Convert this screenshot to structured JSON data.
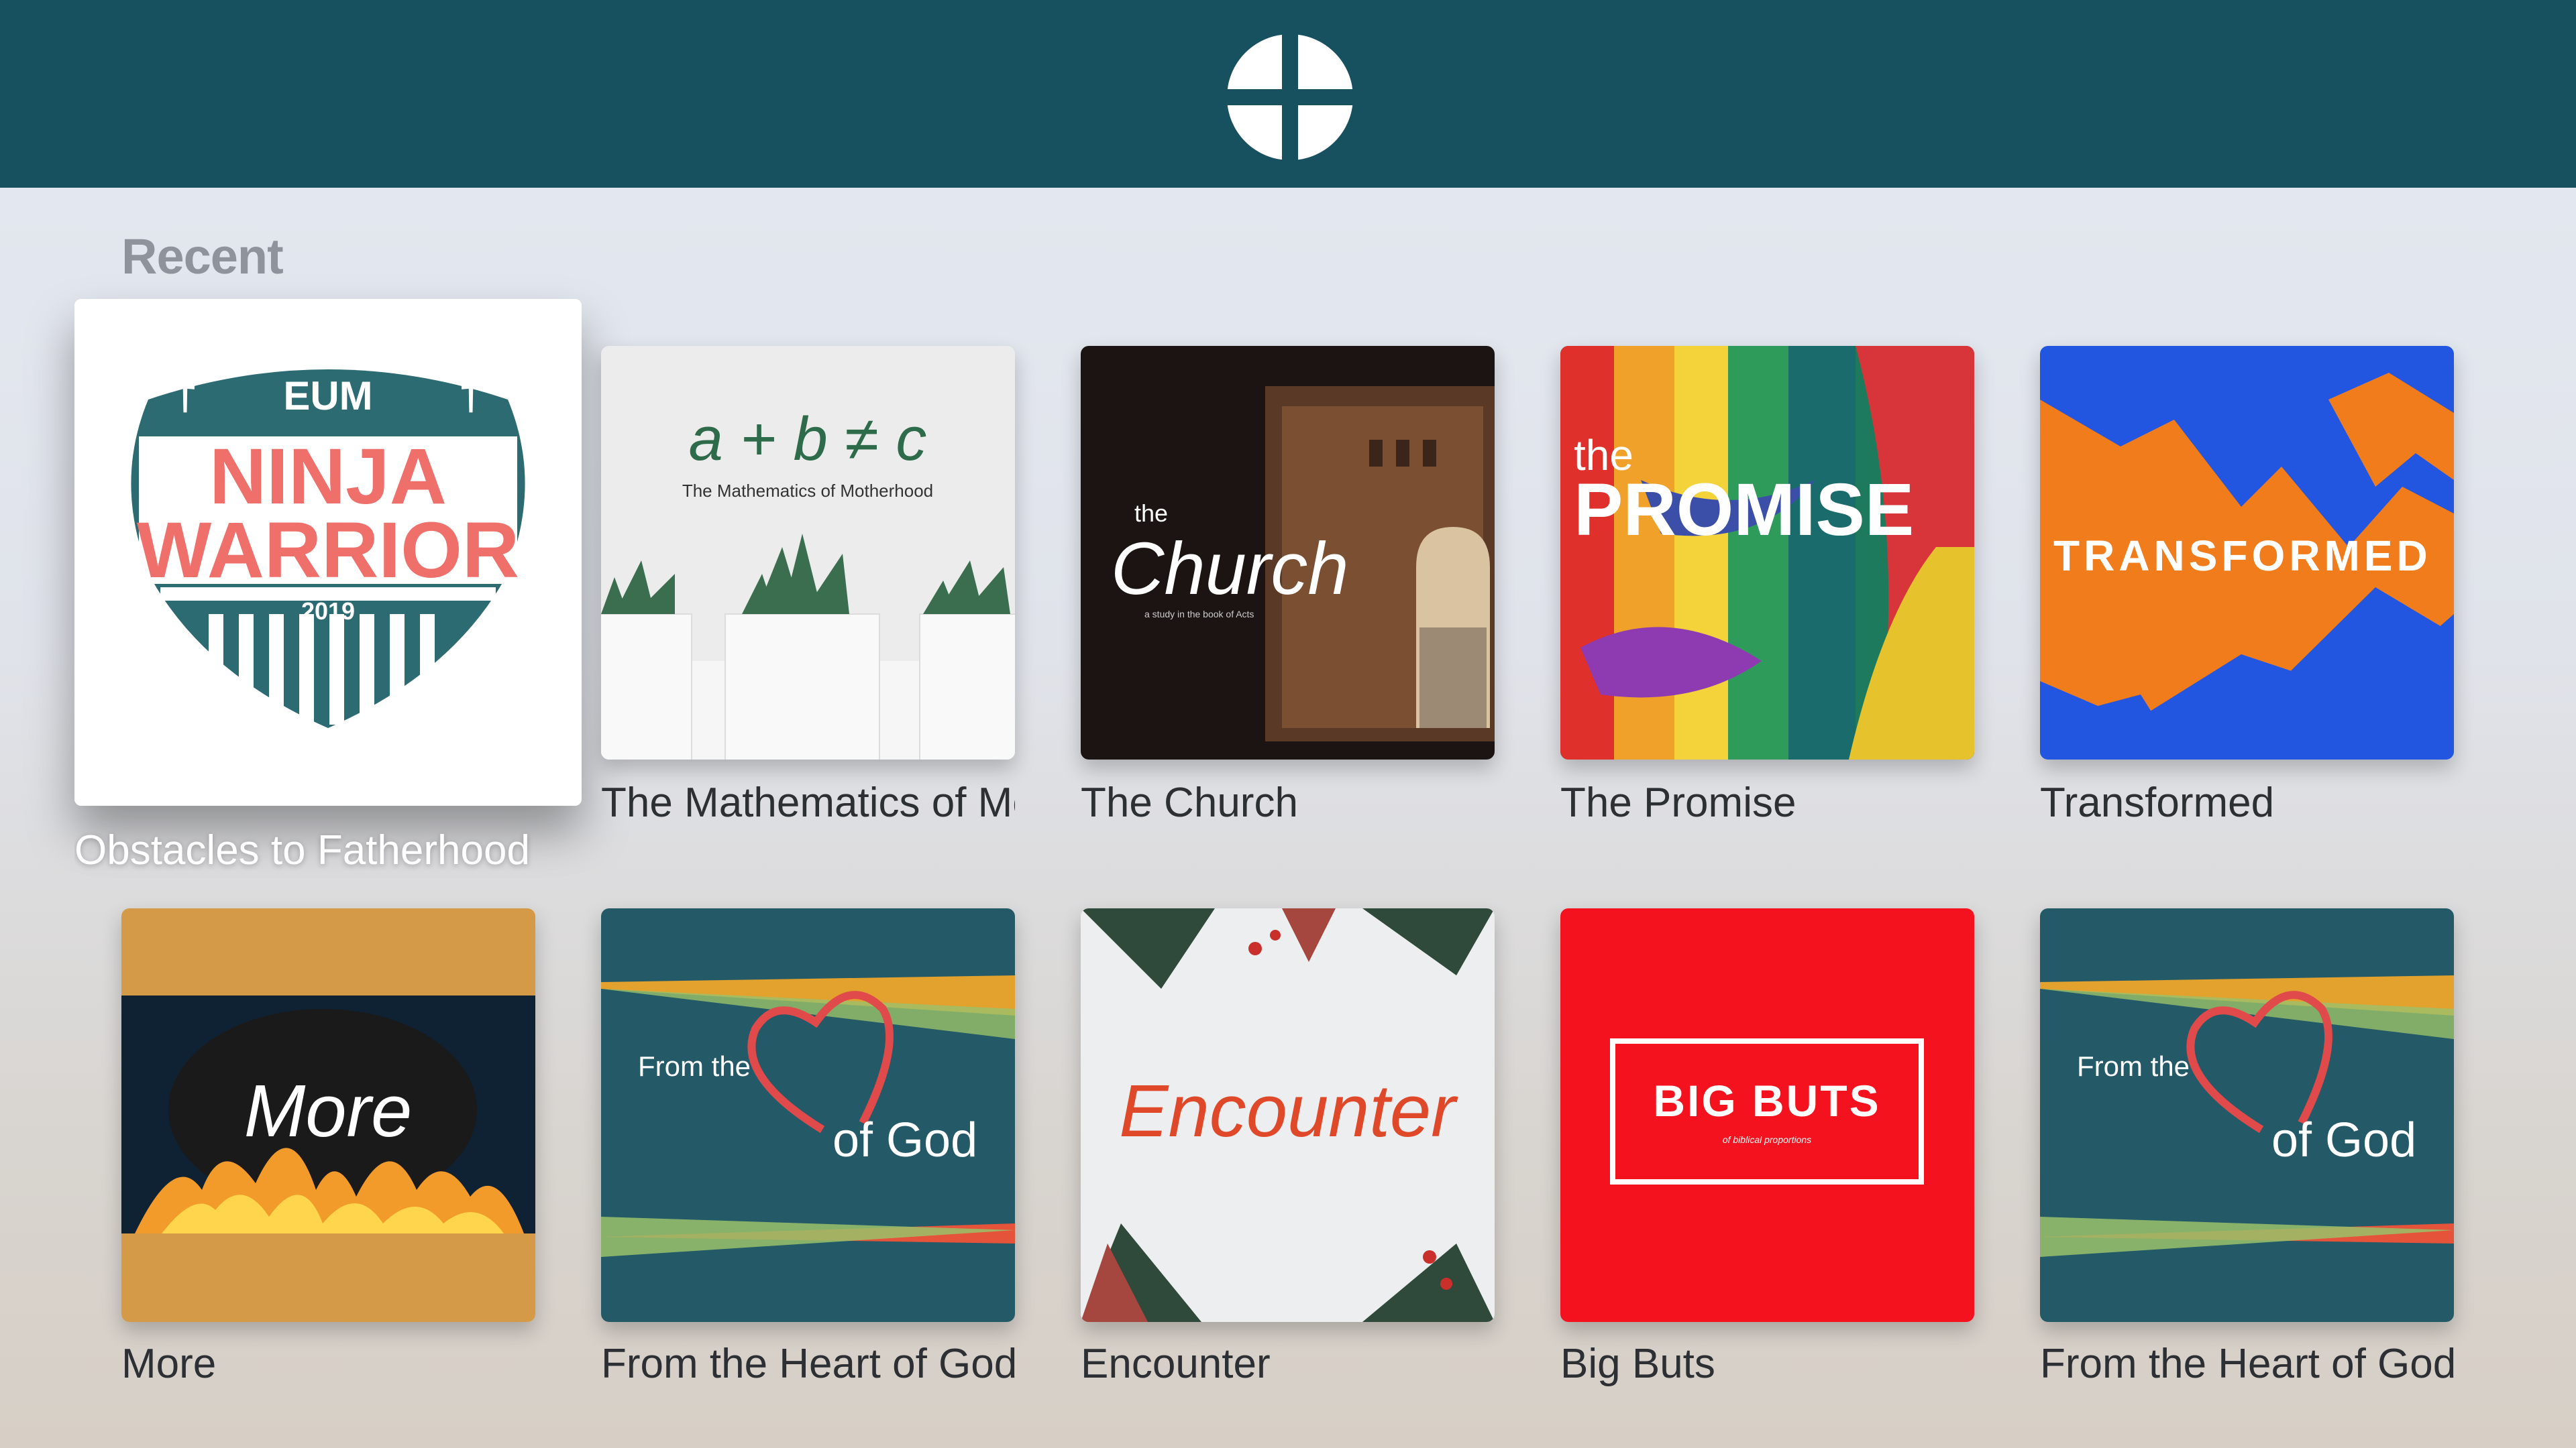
{
  "app": {
    "logo_icon": "cross-circle-icon"
  },
  "section": {
    "title": "Recent"
  },
  "items": [
    {
      "title": "Obstacles to Fatherhood",
      "art_icon": "eum-ninja-warrior-badge",
      "art_text": {
        "top": "EUM",
        "line1": "NINJA",
        "line2": "WARRIOR",
        "year": "2019"
      },
      "focused": true
    },
    {
      "title": "The Mathematics of Motherhood",
      "art_icon": "succulent-pots",
      "art_text": {
        "formula": "a + b ≠ c",
        "subtitle": "The Mathematics of Motherhood"
      }
    },
    {
      "title": "The Church",
      "art_icon": "arched-window",
      "art_text": {
        "pre": "the",
        "main": "Church",
        "sub": "a study in the book of Acts"
      }
    },
    {
      "title": "The Promise",
      "art_icon": "colorful-paint-strokes",
      "art_text": {
        "pre": "the",
        "main": "PROMISE"
      }
    },
    {
      "title": "Transformed",
      "art_icon": "orange-blue-mountains",
      "art_text": {
        "main": "TRANSFORMED"
      }
    },
    {
      "title": "More",
      "art_icon": "flames",
      "art_text": {
        "main": "More"
      }
    },
    {
      "title": "From the Heart of God",
      "art_icon": "heart-outline",
      "art_text": {
        "pre": "From the",
        "main": "of God"
      }
    },
    {
      "title": "Encounter",
      "art_icon": "pine-branches-berries",
      "art_text": {
        "main": "Encounter"
      }
    },
    {
      "title": "Big Buts",
      "art_icon": "red-box",
      "art_text": {
        "main": "BIG BUTS",
        "sub": "of biblical proportions"
      }
    },
    {
      "title": "From the Heart of God",
      "art_icon": "heart-outline",
      "art_text": {
        "pre": "From the",
        "main": "of God"
      }
    }
  ],
  "colors": {
    "header": "#17505f",
    "section_title": "#8f949c",
    "caption": "#2c2f33"
  }
}
